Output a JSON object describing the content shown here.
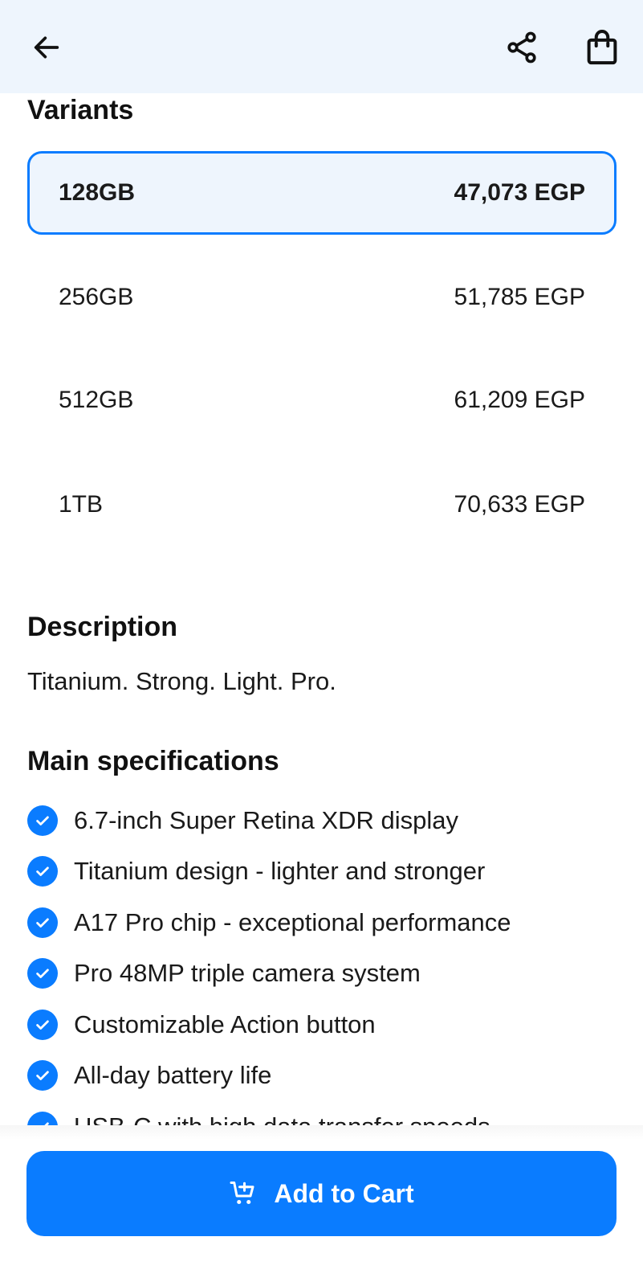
{
  "header": {
    "back_icon": "arrow-left-icon",
    "share_icon": "share-icon",
    "bag_icon": "shopping-bag-icon",
    "background": "#eef5fd"
  },
  "variants": {
    "title": "Variants",
    "items": [
      {
        "label": "128GB",
        "price": "47,073 EGP",
        "selected": true
      },
      {
        "label": "256GB",
        "price": "51,785 EGP",
        "selected": false
      },
      {
        "label": "512GB",
        "price": "61,209 EGP",
        "selected": false
      },
      {
        "label": "1TB",
        "price": "70,633 EGP",
        "selected": false
      }
    ]
  },
  "description": {
    "title": "Description",
    "text": "Titanium. Strong. Light. Pro."
  },
  "specs": {
    "title": "Main specifications",
    "items": [
      "6.7-inch Super Retina XDR display",
      "Titanium design - lighter and stronger",
      "A17 Pro chip - exceptional performance",
      "Pro 48MP triple camera system",
      "Customizable Action button",
      "All-day battery life",
      "USB-C with high data transfer speeds"
    ]
  },
  "cart": {
    "label": "Add to Cart",
    "icon": "add-to-cart-icon"
  },
  "colors": {
    "accent": "#0a7cff",
    "selected_bg": "#eef5fd"
  }
}
